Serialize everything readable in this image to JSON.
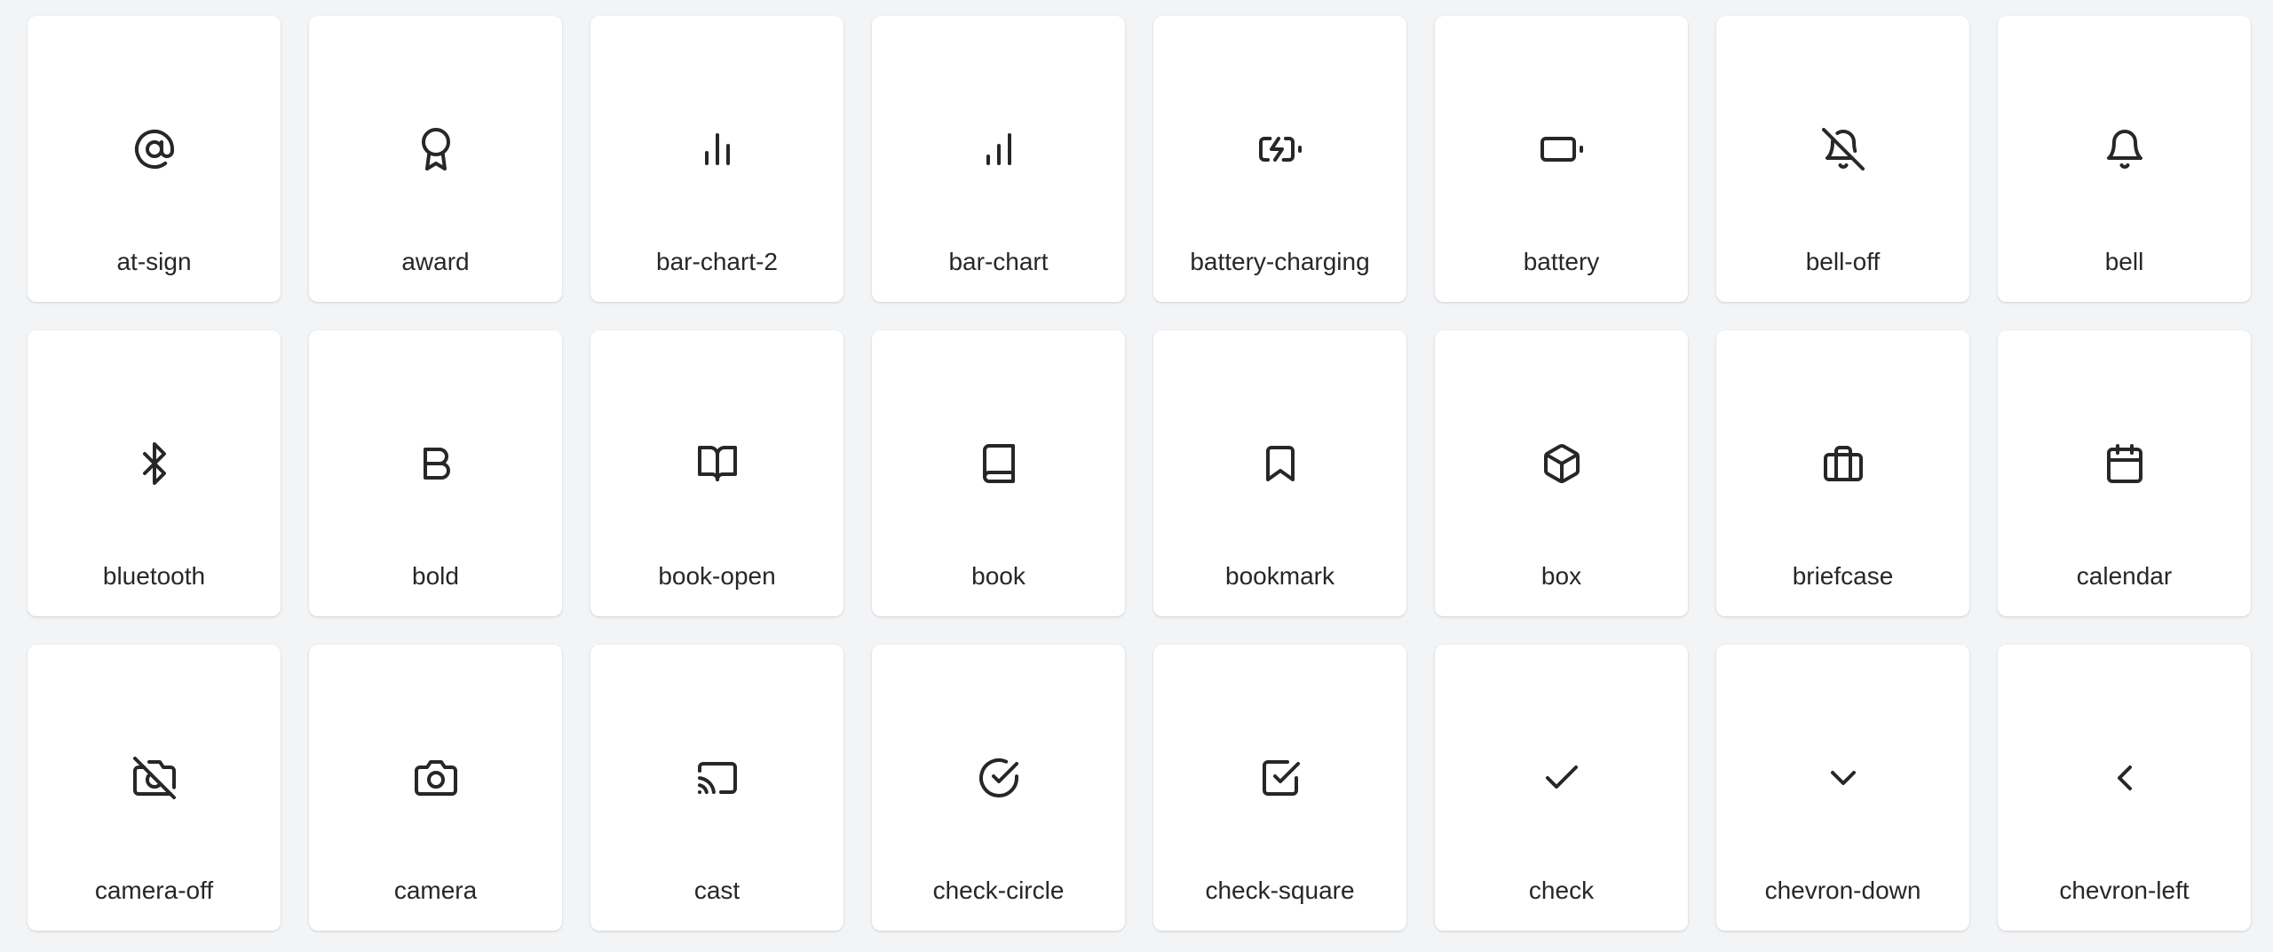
{
  "icons": [
    {
      "label": "at-sign",
      "icon": "at-sign-icon"
    },
    {
      "label": "award",
      "icon": "award-icon"
    },
    {
      "label": "bar-chart-2",
      "icon": "bar-chart-2-icon"
    },
    {
      "label": "bar-chart",
      "icon": "bar-chart-icon"
    },
    {
      "label": "battery-charging",
      "icon": "battery-charging-icon"
    },
    {
      "label": "battery",
      "icon": "battery-icon"
    },
    {
      "label": "bell-off",
      "icon": "bell-off-icon"
    },
    {
      "label": "bell",
      "icon": "bell-icon"
    },
    {
      "label": "bluetooth",
      "icon": "bluetooth-icon"
    },
    {
      "label": "bold",
      "icon": "bold-icon"
    },
    {
      "label": "book-open",
      "icon": "book-open-icon"
    },
    {
      "label": "book",
      "icon": "book-icon"
    },
    {
      "label": "bookmark",
      "icon": "bookmark-icon"
    },
    {
      "label": "box",
      "icon": "box-icon"
    },
    {
      "label": "briefcase",
      "icon": "briefcase-icon"
    },
    {
      "label": "calendar",
      "icon": "calendar-icon"
    },
    {
      "label": "camera-off",
      "icon": "camera-off-icon"
    },
    {
      "label": "camera",
      "icon": "camera-icon"
    },
    {
      "label": "cast",
      "icon": "cast-icon"
    },
    {
      "label": "check-circle",
      "icon": "check-circle-icon"
    },
    {
      "label": "check-square",
      "icon": "check-square-icon"
    },
    {
      "label": "check",
      "icon": "check-icon"
    },
    {
      "label": "chevron-down",
      "icon": "chevron-down-icon"
    },
    {
      "label": "chevron-left",
      "icon": "chevron-left-icon"
    }
  ],
  "colors": {
    "background": "#f3f4f6",
    "card": "#ffffff",
    "text": "#27272a"
  }
}
